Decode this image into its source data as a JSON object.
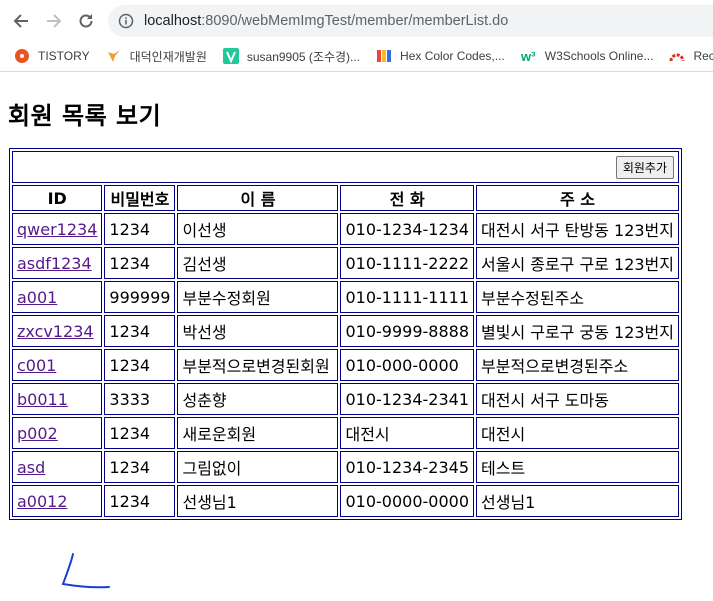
{
  "browser": {
    "url_host": "localhost",
    "url_rest": ":8090/webMemImgTest/member/memberList.do"
  },
  "bookmarks": [
    {
      "label": "TISTORY",
      "icon": "tistory-icon",
      "color": "#eb531f"
    },
    {
      "label": "대덕인재개발원",
      "icon": "daedeok-icon",
      "color": "#f0a030"
    },
    {
      "label": "susan9905 (조수경)...",
      "icon": "velog-icon",
      "color": "#20c997"
    },
    {
      "label": "Hex Color Codes,...",
      "icon": "hex-color-icon",
      "color": "#3a6fd8"
    },
    {
      "label": "W3Schools Online...",
      "icon": "w3schools-icon",
      "color": "#04aa6d"
    },
    {
      "label": "Rec",
      "icon": "rec-icon",
      "color": "#d93025"
    }
  ],
  "page": {
    "title": "회원 목록 보기",
    "add_button": "회원추가",
    "columns": [
      "ID",
      "비밀번호",
      "이 름",
      "전 화",
      "주 소"
    ],
    "rows": [
      [
        "qwer1234",
        "1234",
        "이선생",
        "010-1234-1234",
        "대전시 서구 탄방동 123번지"
      ],
      [
        "asdf1234",
        "1234",
        "김선생",
        "010-1111-2222",
        "서울시 종로구 구로 123번지"
      ],
      [
        "a001",
        "999999",
        "부분수정회원",
        "010-1111-1111",
        "부분수정된주소"
      ],
      [
        "zxcv1234",
        "1234",
        "박선생",
        "010-9999-8888",
        "별빛시 구로구 궁동 123번지"
      ],
      [
        "c001",
        "1234",
        "부분적으로변경된회원",
        "010-000-0000",
        "부분적으로변경된주소"
      ],
      [
        "b0011",
        "3333",
        "성춘향",
        "010-1234-2341",
        "대전시 서구 도마동"
      ],
      [
        "p002",
        "1234",
        "새로운회원",
        "대전시",
        "대전시"
      ],
      [
        "asd",
        "1234",
        "그림없이",
        "010-1234-2345",
        "테스트"
      ],
      [
        "a0012",
        "1234",
        "선생님1",
        "010-0000-0000",
        "선생님1"
      ]
    ]
  }
}
